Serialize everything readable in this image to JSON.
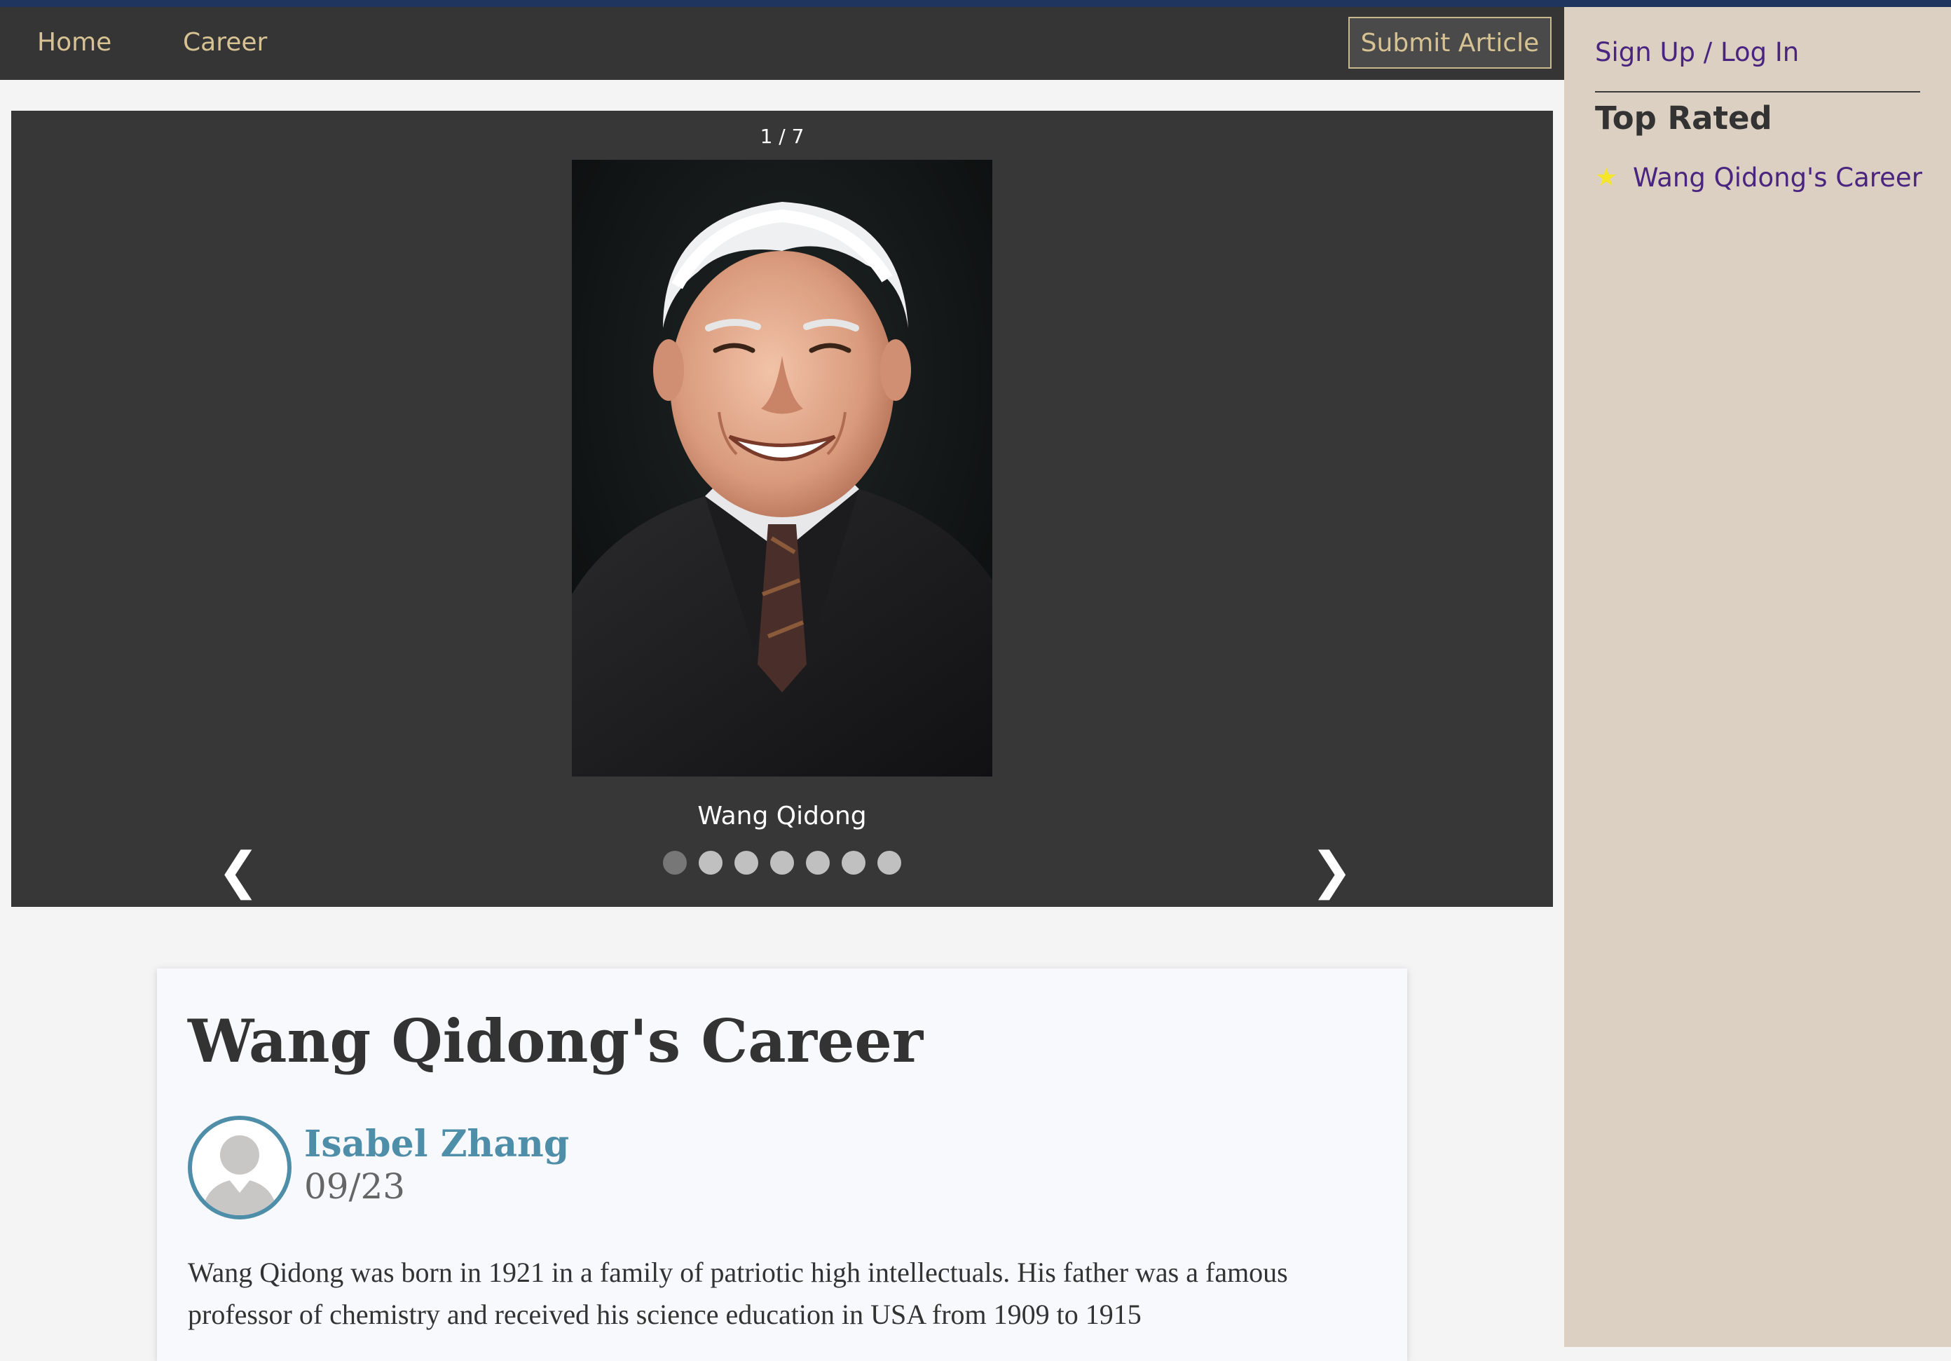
{
  "nav": {
    "home": "Home",
    "career": "Career",
    "submit": "Submit Article"
  },
  "sidebar": {
    "signin": "Sign Up / Log In",
    "top_rated_heading": "Top Rated",
    "top_rated_items": [
      {
        "label": "Wang Qidong's Career",
        "icon": "star-icon"
      }
    ]
  },
  "slider": {
    "counter": "1 / 7",
    "caption": "Wang Qidong",
    "total_slides": 7,
    "active_slide": 1,
    "prev": "❮",
    "next": "❯"
  },
  "article": {
    "title": "Wang Qidong's Career",
    "author": "Isabel Zhang",
    "date": "09/23",
    "body": "Wang Qidong was born in 1921 in a family of patriotic high intellectuals. His father was a famous professor of chemistry and received his science education in USA from 1909 to 1915"
  },
  "colors": {
    "nav_bg": "#353535",
    "nav_text": "#d6c293",
    "sidebar_bg": "#dbd0c2",
    "link": "#4a2580",
    "author": "#4f8ea8"
  }
}
